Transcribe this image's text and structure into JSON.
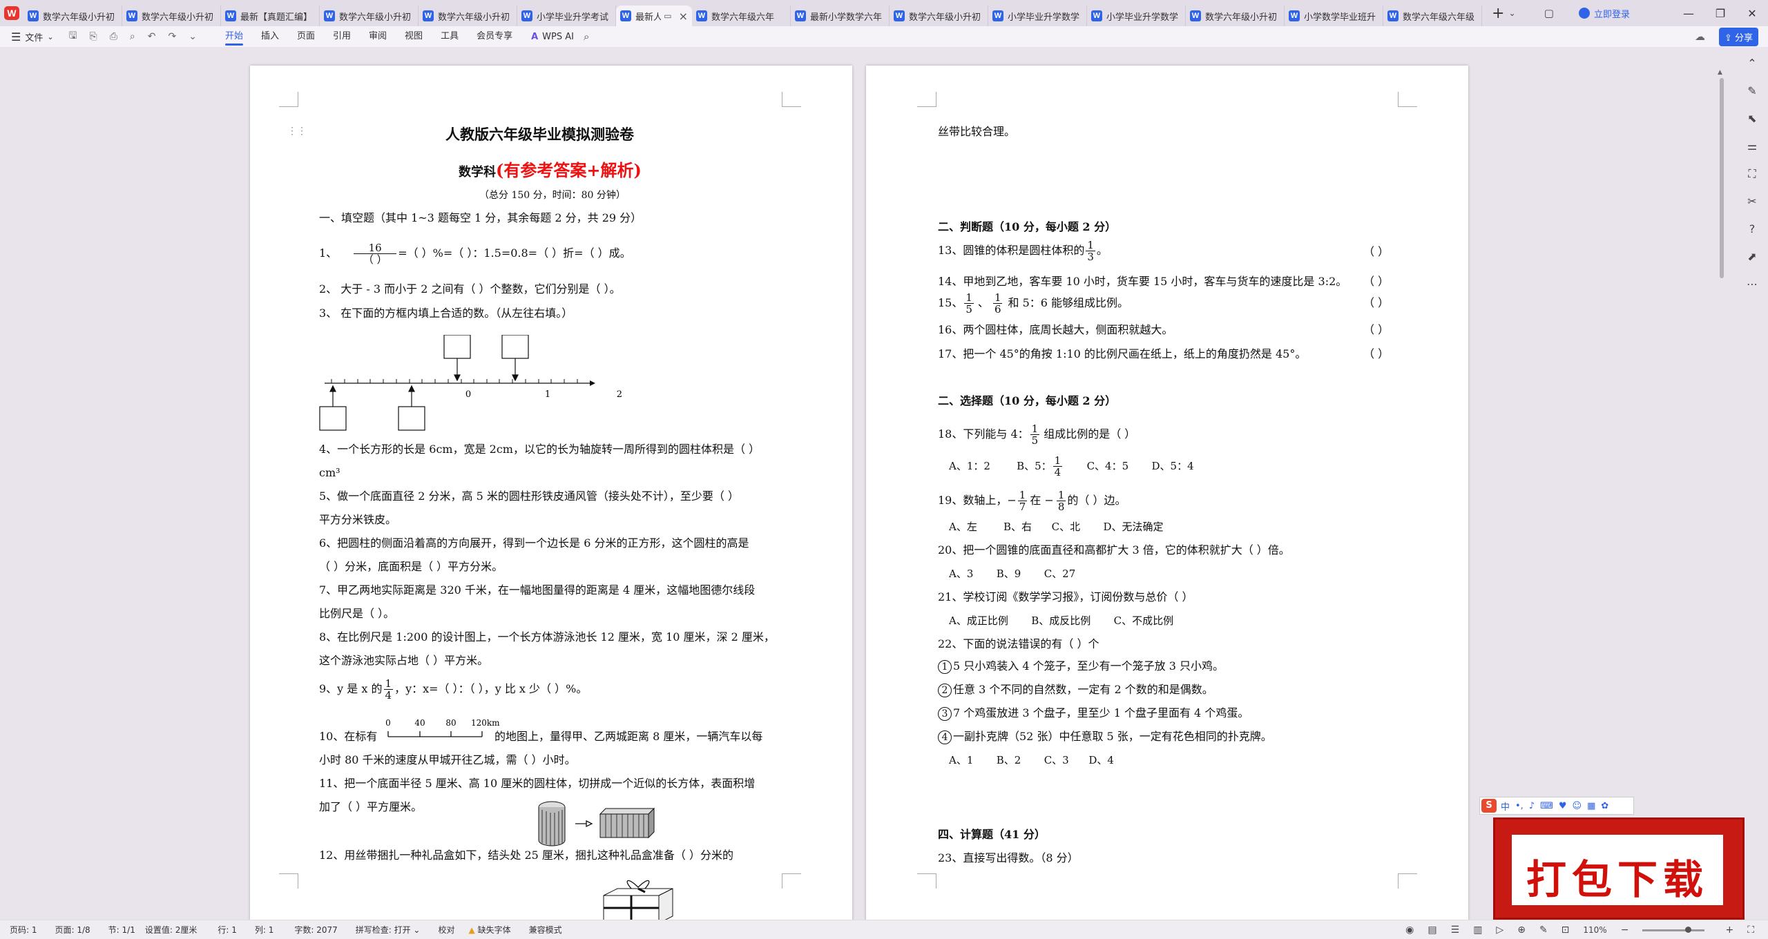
{
  "window": {
    "tabs": [
      {
        "label": "数学六年级小升初"
      },
      {
        "label": "数学六年级小升初"
      },
      {
        "label": "最新【真题汇编】"
      },
      {
        "label": "数学六年级小升初"
      },
      {
        "label": "数学六年级小升初"
      },
      {
        "label": "小学毕业升学考试"
      },
      {
        "label": "最新人教版",
        "active": true
      },
      {
        "label": "数学六年级六年"
      },
      {
        "label": "最新小学数学六年"
      },
      {
        "label": "数学六年级小升初"
      },
      {
        "label": "小学毕业升学数学"
      },
      {
        "label": "小学毕业升学数学"
      },
      {
        "label": "数学六年级小升初"
      },
      {
        "label": "小学数学毕业班升"
      },
      {
        "label": "数学六年级六年级"
      }
    ],
    "login_label": "立即登录",
    "app_letter": "W",
    "tab_letter": "W"
  },
  "toolbar": {
    "file_label": "文件",
    "tabs": [
      "开始",
      "插入",
      "页面",
      "引用",
      "审阅",
      "视图",
      "工具",
      "会员专享"
    ],
    "ai_label": "WPS AI",
    "share_label": "分享"
  },
  "page1": {
    "title": "人教版六年级毕业模拟测验卷",
    "subject": "数学科",
    "subject_red": "(有参考答案+解析)",
    "meta": "（总分 150 分，时间：80 分钟）",
    "section1": "一、填空题（其中 1~3 题每空 1 分，其余每题 2 分，共 29 分）",
    "q1_num": "1、",
    "q1_frac_num": "16",
    "q1_frac_den": "（    ）",
    "q1_rest": "=（    ）%=（    ）：1.5=0.8=（    ）折=（    ）成。",
    "q2": "2、   大于 - 3 而小于 2 之间有（    ）个整数，它们分别是（                       ）。",
    "q3": "3、   在下面的方框内填上合适的数。（从左往右填。）",
    "numberline_labels": [
      "0",
      "1",
      "2"
    ],
    "q4a": "4、一个长方形的长是 6cm，宽是 2cm，以它的长为轴旋转一周所得到的圆柱体积是（    ）",
    "q4b": "cm³",
    "q5a": "5、做一个底面直径 2 分米，高 5 米的圆柱形铁皮通风管（接头处不计），至少要（    ）",
    "q5b": "平方分米铁皮。",
    "q6a": "6、把圆柱的侧面沿着高的方向展开，得到一个边长是 6 分米的正方形，这个圆柱的高是",
    "q6b": "（    ）分米，底面积是（    ）平方分米。",
    "q7a": "7、甲乙两地实际距离是 320 千米，在一幅地图量得的距离是 4 厘米，这幅地图德尔线段",
    "q7b": "比例尺是（                 ）。",
    "q8a": "8、在比例尺是 1:200 的设计图上，一个长方体游泳池长 12 厘米，宽 10 厘米，深 2 厘米，",
    "q8b": "这个游泳池实际占地（         ）平方米。",
    "q9_pre": "9、y 是 x 的",
    "q9_frac_num": "1",
    "q9_frac_den": "4",
    "q9_rest": "，y：x=（    ）：（    ），y 比 x 少（    ）%。",
    "scale_labels": [
      "0",
      "40",
      "80",
      "120km"
    ],
    "q10a_pre": "10、在标有",
    "q10a_post": "的地图上，量得甲、乙两城距离 8 厘米，一辆汽车以每",
    "q10b": "小时 80 千米的速度从甲城开往乙城，需（        ）小时。",
    "q11a": "11、把一个底面半径 5 厘米、高 10 厘米的圆柱体，切拼成一个近似的长方体，表面积增",
    "q11b": "加了（    ）平方厘米。",
    "q12": "12、用丝带捆扎一种礼品盒如下，结头处 25 厘米，捆扎这种礼品盒准备（        ）分米的"
  },
  "page2": {
    "cont": "丝带比较合理。",
    "section2": "二、判断题（10 分，每小题 2 分）",
    "q13_pre": "13、圆锥的体积是圆柱体积的",
    "q13_frac_num": "1",
    "q13_frac_den": "3",
    "q13_post": "。",
    "q14": "14、甲地到乙地，客车要 10 小时，货车要 15 小时，客车与货车的速度比是 3:2。",
    "q15_pre": "15、",
    "q15_f1n": "1",
    "q15_f1d": "5",
    "q15_f2n": "1",
    "q15_f2d": "6",
    "q15_post": "和 5：6 能够组成比例。",
    "q16": "16、两个圆柱体，底周长越大，侧面积就越大。",
    "q17": "17、把一个 45°的角按 1:10 的比例尺画在纸上，纸上的角度扔然是 45°。",
    "paren": "（    ）",
    "section3": "二、选择题（10 分，每小题 2 分）",
    "q18_pre": "18、下列能与 4：",
    "q18_frac_num": "1",
    "q18_frac_den": "5",
    "q18_post": "组成比例的是（    ）",
    "q18_opts_pre": "A、1：2        B、5：",
    "q18_opt_frac_num": "1",
    "q18_opt_frac_den": "4",
    "q18_opts_post": "       C、4：5       D、5：4",
    "q19_pre": "19、数轴上，−",
    "q19_f1n": "1",
    "q19_f1d": "7",
    "q19_mid": "在 −",
    "q19_f2n": "1",
    "q19_f2d": "8",
    "q19_post": "的（    ）边。",
    "q19_opts": "A、左        B、右      C、北       D、无法确定",
    "q20": "20、把一个圆锥的底面直径和高都扩大 3 倍，它的体积就扩大（       ）倍。",
    "q20_opts": "A、3       B、9       C、27",
    "q21": "21、学校订阅《数学学习报》，订阅份数与总价（       ）",
    "q21_opts": "A、成正比例       B、成反比例       C、不成比例",
    "q22": "22、下面的说法错误的有（    ）个",
    "q22_items": [
      {
        "n": "1",
        "t": "5 只小鸡装入 4 个笼子，至少有一个笼子放 3 只小鸡。"
      },
      {
        "n": "2",
        "t": "任意 3 个不同的自然数，一定有 2 个数的和是偶数。"
      },
      {
        "n": "3",
        "t": "7 个鸡蛋放进 3 个盘子，里至少 1 个盘子里面有 4 个鸡蛋。"
      },
      {
        "n": "4",
        "t": "一副扑克牌（52 张）中任意取 5 张，一定有花色相同的扑克牌。"
      }
    ],
    "q22_opts": "A、1       B、2       C、3      D、4",
    "section4": "四、计算题（41 分）",
    "q23": "23、直接写出得数。（8 分）"
  },
  "status": {
    "page_num": "页码: 1",
    "pages": "页面: 1/8",
    "section": "节: 1/1",
    "setting": "设置值: 2厘米",
    "row": "行: 1",
    "col": "列: 1",
    "words": "字数: 2077",
    "spell": "拼写检查: 打开",
    "proof": "校对",
    "font_missing": "缺失字体",
    "compat": "兼容模式",
    "zoom": "110%"
  },
  "ime": {
    "logo": "S",
    "mode": "中"
  },
  "promo": {
    "text": "打包下载"
  }
}
